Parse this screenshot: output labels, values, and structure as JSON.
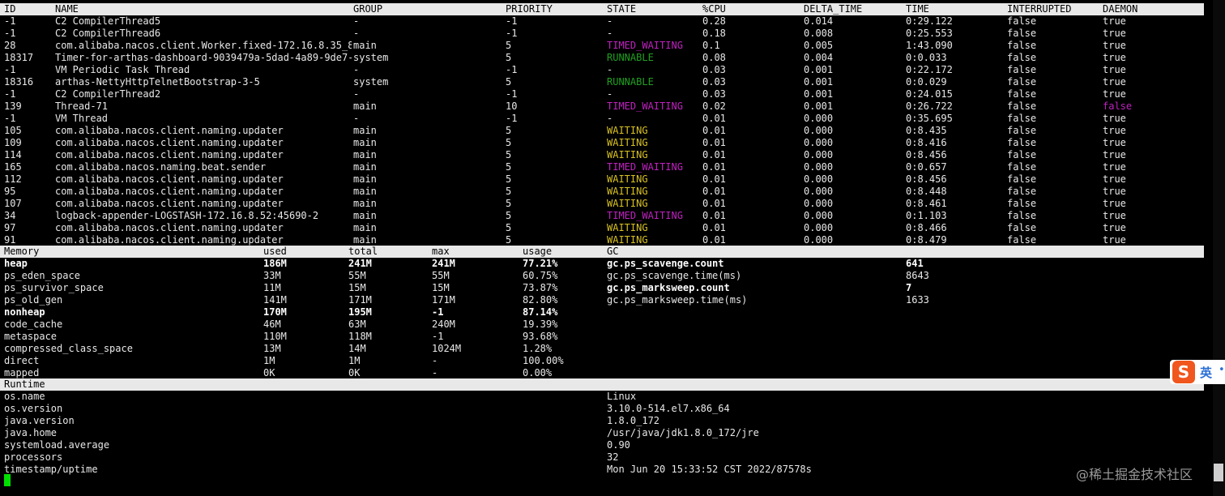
{
  "threads": {
    "headers": [
      "ID",
      "NAME",
      "GROUP",
      "PRIORITY",
      "STATE",
      "%CPU",
      "DELTA_TIME",
      "TIME",
      "INTERRUPTED",
      "DAEMON"
    ],
    "rows": [
      [
        "-1",
        "C2 CompilerThread5",
        "-",
        "-1",
        "-",
        "0.28",
        "0.014",
        "0:29.122",
        "false",
        "true"
      ],
      [
        "-1",
        "C2 CompilerThread6",
        "-",
        "-1",
        "-",
        "0.18",
        "0.008",
        "0:25.553",
        "false",
        "true"
      ],
      [
        "28",
        "com.alibaba.nacos.client.Worker.fixed-172.16.8.35_83",
        "main",
        "5",
        "TIMED_WAITING",
        "0.1",
        "0.005",
        "1:43.090",
        "false",
        "true"
      ],
      [
        "18317",
        "Timer-for-arthas-dashboard-9039479a-5dad-4a89-9de7-b",
        "system",
        "5",
        "RUNNABLE",
        "0.08",
        "0.004",
        "0:0.033",
        "false",
        "true"
      ],
      [
        "-1",
        "VM Periodic Task Thread",
        "-",
        "-1",
        "-",
        "0.03",
        "0.001",
        "0:22.172",
        "false",
        "true"
      ],
      [
        "18316",
        "arthas-NettyHttpTelnetBootstrap-3-5",
        "system",
        "5",
        "RUNNABLE",
        "0.03",
        "0.001",
        "0:0.029",
        "false",
        "true"
      ],
      [
        "-1",
        "C2 CompilerThread2",
        "-",
        "-1",
        "-",
        "0.03",
        "0.001",
        "0:24.015",
        "false",
        "true"
      ],
      [
        "139",
        "Thread-71",
        "main",
        "10",
        "TIMED_WAITING",
        "0.02",
        "0.001",
        "0:26.722",
        "false",
        "false"
      ],
      [
        "-1",
        "VM Thread",
        "-",
        "-1",
        "-",
        "0.01",
        "0.000",
        "0:35.695",
        "false",
        "true"
      ],
      [
        "105",
        "com.alibaba.nacos.client.naming.updater",
        "main",
        "5",
        "WAITING",
        "0.01",
        "0.000",
        "0:8.435",
        "false",
        "true"
      ],
      [
        "109",
        "com.alibaba.nacos.client.naming.updater",
        "main",
        "5",
        "WAITING",
        "0.01",
        "0.000",
        "0:8.416",
        "false",
        "true"
      ],
      [
        "114",
        "com.alibaba.nacos.client.naming.updater",
        "main",
        "5",
        "WAITING",
        "0.01",
        "0.000",
        "0:8.456",
        "false",
        "true"
      ],
      [
        "165",
        "com.alibaba.nacos.naming.beat.sender",
        "main",
        "5",
        "TIMED_WAITING",
        "0.01",
        "0.000",
        "0:0.657",
        "false",
        "true"
      ],
      [
        "112",
        "com.alibaba.nacos.client.naming.updater",
        "main",
        "5",
        "WAITING",
        "0.01",
        "0.000",
        "0:8.456",
        "false",
        "true"
      ],
      [
        "95",
        "com.alibaba.nacos.client.naming.updater",
        "main",
        "5",
        "WAITING",
        "0.01",
        "0.000",
        "0:8.448",
        "false",
        "true"
      ],
      [
        "107",
        "com.alibaba.nacos.client.naming.updater",
        "main",
        "5",
        "WAITING",
        "0.01",
        "0.000",
        "0:8.461",
        "false",
        "true"
      ],
      [
        "34",
        "logback-appender-LOGSTASH-172.16.8.52:45690-2",
        "main",
        "5",
        "TIMED_WAITING",
        "0.01",
        "0.000",
        "0:1.103",
        "false",
        "true"
      ],
      [
        "97",
        "com.alibaba.nacos.client.naming.updater",
        "main",
        "5",
        "WAITING",
        "0.01",
        "0.000",
        "0:8.466",
        "false",
        "true"
      ],
      [
        "91",
        "com.alibaba.nacos.client.naming.updater",
        "main",
        "5",
        "WAITING",
        "0.01",
        "0.000",
        "0:8.479",
        "false",
        "true"
      ]
    ]
  },
  "memory": {
    "headers": [
      "Memory",
      "used",
      "total",
      "max",
      "usage",
      "GC"
    ],
    "rows": [
      {
        "cells": [
          "heap",
          "186M",
          "241M",
          "241M",
          "77.21%"
        ],
        "bold": true
      },
      {
        "cells": [
          "ps_eden_space",
          "33M",
          "55M",
          "55M",
          "60.75%"
        ],
        "bold": false
      },
      {
        "cells": [
          "ps_survivor_space",
          "11M",
          "15M",
          "15M",
          "73.87%"
        ],
        "bold": false
      },
      {
        "cells": [
          "ps_old_gen",
          "141M",
          "171M",
          "171M",
          "82.80%"
        ],
        "bold": false
      },
      {
        "cells": [
          "nonheap",
          "170M",
          "195M",
          "-1",
          "87.14%"
        ],
        "bold": true
      },
      {
        "cells": [
          "code_cache",
          "46M",
          "63M",
          "240M",
          "19.39%"
        ],
        "bold": false
      },
      {
        "cells": [
          "metaspace",
          "110M",
          "118M",
          "-1",
          "93.68%"
        ],
        "bold": false
      },
      {
        "cells": [
          "compressed_class_space",
          "13M",
          "14M",
          "1024M",
          "1.28%"
        ],
        "bold": false
      },
      {
        "cells": [
          "direct",
          "1M",
          "1M",
          "-",
          "100.00%"
        ],
        "bold": false
      },
      {
        "cells": [
          "mapped",
          "0K",
          "0K",
          "-",
          "0.00%"
        ],
        "bold": false
      }
    ],
    "gc": [
      {
        "name": "gc.ps_scavenge.count",
        "value": "641",
        "bold": true
      },
      {
        "name": "gc.ps_scavenge.time(ms)",
        "value": "8643",
        "bold": false
      },
      {
        "name": "gc.ps_marksweep.count",
        "value": "7",
        "bold": true
      },
      {
        "name": "gc.ps_marksweep.time(ms)",
        "value": "1633",
        "bold": false
      }
    ]
  },
  "runtime": {
    "header": "Runtime",
    "rows": [
      [
        "os.name",
        "Linux"
      ],
      [
        "os.version",
        "3.10.0-514.el7.x86_64"
      ],
      [
        "java.version",
        "1.8.0_172"
      ],
      [
        "java.home",
        "/usr/java/jdk1.8.0_172/jre"
      ],
      [
        "systemload.average",
        "0.90"
      ],
      [
        "processors",
        "32"
      ],
      [
        "timestamp/uptime",
        "Mon Jun 20 15:33:52 CST 2022/87578s"
      ]
    ]
  },
  "ime": {
    "logo": "S",
    "lang": "英",
    "icon": "ime-toolbar-icon"
  },
  "watermark": "@稀土掘金技术社区",
  "state_colors": {
    "TIMED_WAITING": "#c020c0",
    "RUNNABLE": "#20a020",
    "WAITING": "#d8c020"
  }
}
